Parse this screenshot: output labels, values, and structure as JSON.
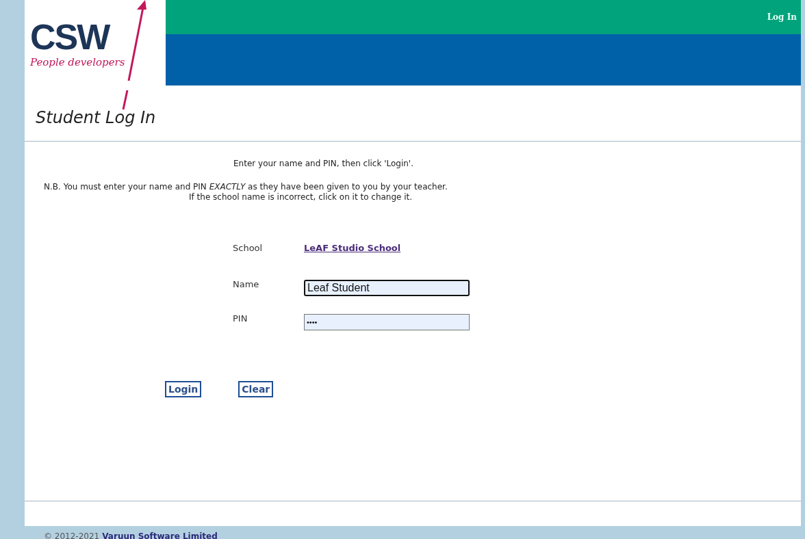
{
  "logo": {
    "name": "CSW",
    "tagline": "People developers"
  },
  "header": {
    "link": "Log In"
  },
  "page_title": "Student Log In",
  "instructions": {
    "line_1": "Enter your name and PIN, then click 'Login'.",
    "line_2": "N.B. You must enter your name and PIN *EXACTLY* as they have been given to you by your teacher.",
    "line_3": "If the school name is incorrect, click on it to change it."
  },
  "form": {
    "school": {
      "label": "School",
      "value": "LeAF Studio School"
    },
    "fields": [
      {
        "label": "Name",
        "value": "Leaf Student",
        "focused": true
      },
      {
        "label": "PIN",
        "value": "••••",
        "focused": false
      }
    ]
  },
  "buttons": [
    "Login",
    "Clear"
  ],
  "footer": {
    "copyright": "© 2012-2021",
    "company": "Varuun Software Limited"
  }
}
